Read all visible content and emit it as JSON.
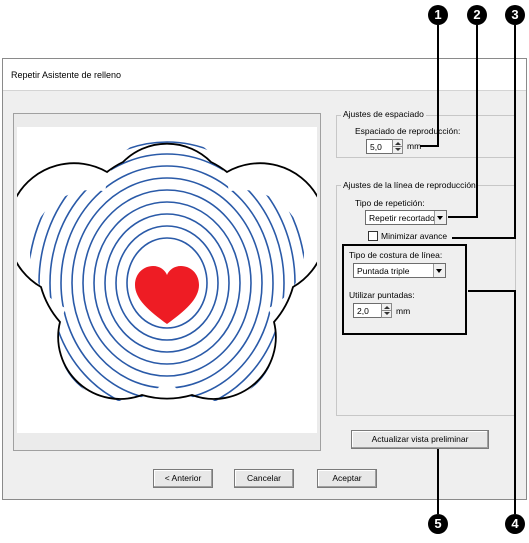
{
  "dialog": {
    "title": "Repetir Asistente de relleno",
    "spacing_group": {
      "legend": "Ajustes de espaciado",
      "label": "Espaciado de reproducción:",
      "value": "5,0",
      "unit": "mm"
    },
    "line_group": {
      "legend": "Ajustes de la línea de reproducción",
      "repeat_type_label": "Tipo de repetición:",
      "repeat_type_value": "Repetir recortados",
      "minimize_label": "Minimizar avance",
      "minimize_checked": false,
      "stitch_type_label": "Tipo de costura de línea:",
      "stitch_type_value": "Puntada triple",
      "use_stitches_label": "Utilizar puntadas:",
      "use_stitches_value": "2,0",
      "use_stitches_unit": "mm"
    },
    "update_preview_button": "Actualizar vista preliminar",
    "buttons": {
      "back": "< Anterior",
      "cancel": "Cancelar",
      "accept": "Aceptar"
    }
  },
  "callouts": [
    "1",
    "2",
    "3",
    "4",
    "5"
  ],
  "colors": {
    "contour_lines": "#2a5aa8",
    "heart": "#ee1c24",
    "flower_outline": "#000000"
  }
}
